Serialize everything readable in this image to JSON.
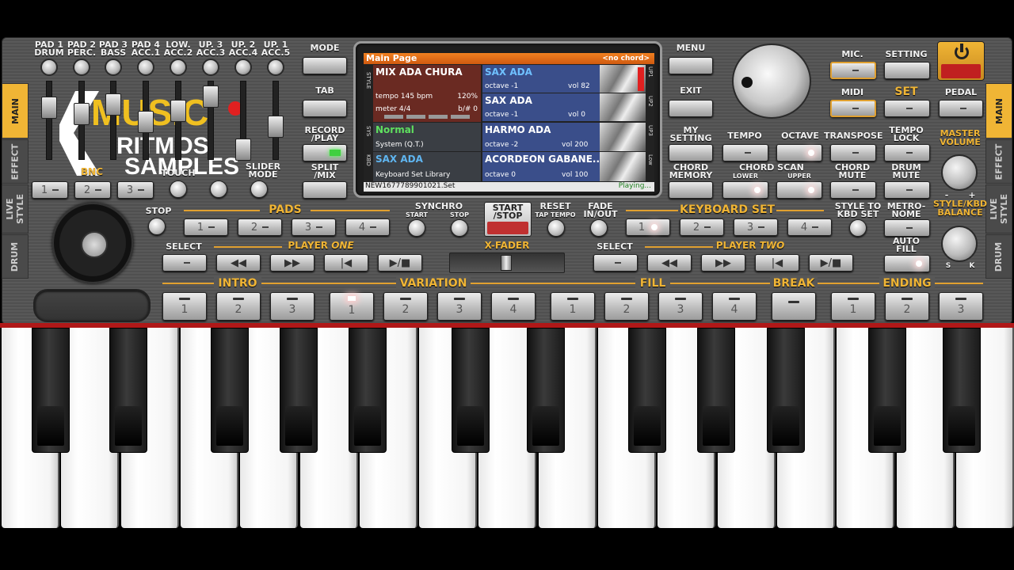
{
  "top_pads": {
    "labels": [
      "PAD 1\nDRUM",
      "PAD 2\nPERC.",
      "PAD 3\nBASS",
      "PAD 4\nACC.1",
      "LOW.\nACC.2",
      "UP. 3\nACC.3",
      "UP. 2\nACC.4",
      "UP. 1\nACC.5"
    ]
  },
  "mixer": {
    "left_label": "BNC",
    "mid_label": "TOUCH",
    "right_label": "SLIDER\nMODE",
    "buttons": [
      "1",
      "2",
      "3"
    ]
  },
  "mode_buttons": {
    "mode": "MODE",
    "tab": "TAB",
    "record": "RECORD\n/PLAY",
    "split": "SPLIT\n/MIX"
  },
  "screen": {
    "header_title": "Main Page",
    "header_chord": "<no chord>",
    "style_side": "STYLE",
    "style_name": "MIX ADA CHURA",
    "style_tempo": "tempo 145 bpm",
    "style_pct": "120%",
    "style_meter": "meter 4/4",
    "style_bsharp": "b/# 0",
    "sys_side": "SYS",
    "sys_name": "Normal",
    "sys_sub": "System (Q.T.)",
    "kbd_side": "KBD",
    "kbd_name": "SAX ADA",
    "kbd_sub": "Keyboard Set Library",
    "up1_name": "SAX ADA",
    "up1_oct": "octave -1",
    "up1_vol": "vol 82",
    "up2_name": "SAX ADA",
    "up2_oct": "octave -1",
    "up2_vol": "vol 0",
    "up3_name": "HARMO ADA",
    "up3_oct": "octave -2",
    "up3_vol": "vol 200",
    "low_name": "ACORDEON GABANE..",
    "low_oct": "octave 0",
    "low_vol": "vol 100",
    "side_up1": "UP1",
    "side_up2": "UP2",
    "side_up3": "UP3",
    "side_low": "Low",
    "footer_file": "NEW1677789901021.Set",
    "footer_status": "Playing..."
  },
  "right_buttons": {
    "menu": "MENU",
    "exit": "EXIT",
    "my_setting": "MY\nSETTING",
    "chord_memory": "CHORD\nMEMORY"
  },
  "top_right": {
    "mic": "MIC.",
    "setting": "SETTING",
    "midi": "MIDI",
    "set": "SET",
    "pedal": "PEDAL"
  },
  "tempo_row": {
    "tempo": "TEMPO",
    "octave": "OCTAVE",
    "transpose": "TRANSPOSE",
    "tempo_lock": "TEMPO\nLOCK",
    "chord_scan": "CHORD SCAN",
    "lower": "LOWER",
    "upper": "UPPER",
    "chord_mute": "CHORD\nMUTE",
    "drum_mute": "DRUM\nMUTE"
  },
  "master": {
    "master_volume": "MASTER\nVOLUME",
    "style_kbd": "STYLE/KBD\nBALANCE",
    "minus": "-",
    "plus": "+",
    "s": "S",
    "k": "K"
  },
  "side_tabs_left": [
    "MAIN",
    "EFFECT",
    "LIVE\nSTYLE",
    "DRUM"
  ],
  "side_tabs_right": [
    "MAIN",
    "EFFECT",
    "LIVE\nSTYLE",
    "DRUM"
  ],
  "pads_row": {
    "stop": "STOP",
    "pads": "PADS",
    "pad_buttons": [
      "1",
      "2",
      "3",
      "4"
    ],
    "synchro": "SYNCHRO",
    "sync_start": "START",
    "sync_stop": "STOP",
    "start_stop": "START\n/STOP",
    "reset": "RESET",
    "tap_tempo": "TAP TEMPO",
    "fade": "FADE\nIN/OUT"
  },
  "keyboard_set": {
    "label": "KEYBOARD SET",
    "buttons": [
      "1",
      "2",
      "3",
      "4"
    ],
    "style_to_kbd": "STYLE TO\nKBD SET",
    "metronome": "METRO-\nNOME",
    "auto_fill": "AUTO\nFILL"
  },
  "players": {
    "select": "SELECT",
    "player_one": "PLAYER",
    "player_one_em": "ONE",
    "player_two": "PLAYER",
    "player_two_em": "TWO",
    "xfader": "X-FADER"
  },
  "sections": {
    "intro": "INTRO",
    "variation": "VARIATION",
    "fill": "FILL",
    "break": "BREAK",
    "ending": "ENDING",
    "intro_buttons": [
      "1",
      "2",
      "3"
    ],
    "variation_buttons": [
      "1",
      "2",
      "3",
      "4"
    ],
    "fill_buttons": [
      "1",
      "2",
      "3",
      "4"
    ],
    "ending_buttons": [
      "1",
      "2",
      "3"
    ]
  },
  "logo": {
    "line1": "MUSIC",
    "line2": "RITMOS",
    "line3": "SAMPLES",
    "letter": "K"
  },
  "colors": {
    "accent": "#f0b535",
    "panel": "#555555",
    "screen_blue": "#3a4e8a",
    "screen_red": "#6a2a22",
    "led_red": "#e02020",
    "led_green": "#40d040"
  }
}
